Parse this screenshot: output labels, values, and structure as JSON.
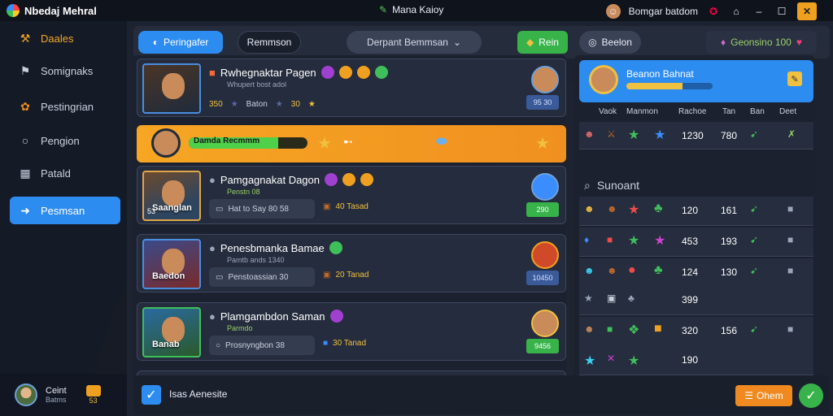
{
  "app": {
    "title": "Nbedaj Mehral",
    "center_title": "Mana Kaioy",
    "user": "Bomgar batdom"
  },
  "sidebar": {
    "items": [
      {
        "label": "Daales",
        "icon": "wrench-icon"
      },
      {
        "label": "Somignaks",
        "icon": "flag-icon"
      },
      {
        "label": "Pestingrian",
        "icon": "gear-icon"
      },
      {
        "label": "Pengion",
        "icon": "circle-icon"
      },
      {
        "label": "Patald",
        "icon": "grid-icon"
      },
      {
        "label": "Pesmsan",
        "icon": "arrow-icon"
      }
    ],
    "profile": {
      "name": "Ceint",
      "sub": "Batms",
      "level": "53"
    }
  },
  "header": {
    "tab_active": "Peringafer",
    "tab2": "Remmson",
    "dropdown": "Derpant Bemmsan",
    "btn_green": "Rein",
    "btn_grey": "Beelon",
    "btn_dark": "Geonsino 100"
  },
  "list": {
    "cards": [
      {
        "name": "Rwhegnaktar Pagen",
        "sub": "Whupert bost adol",
        "stat1": "350",
        "stat2": "Baton",
        "stat3": "30",
        "tag": "95 30"
      },
      {
        "name": "Pamgagnakat Dagon",
        "sub": "Penstn 08",
        "field": "Hat to Say 80 58",
        "coin": "40 Tasad",
        "tag": "290",
        "label": "Saanglan",
        "count": "53"
      },
      {
        "name": "Penesbmanka Bamae",
        "sub": "Pamtb ands 1340",
        "field": "Penstoassian 30",
        "coin": "20 Tanad",
        "tag": "10450",
        "label": "Baedon"
      },
      {
        "name": "Plamgambdon Saman",
        "sub": "Parmdo",
        "field": "Prosnyngbon 38",
        "coin": "30 Tanad",
        "tag": "9456",
        "label": "Banab"
      }
    ],
    "highlight": {
      "label": "Damda Recmmm",
      "progress": 0.75
    }
  },
  "right": {
    "header": {
      "title": "Beanon Bahnat",
      "progress": 0.65
    },
    "columns": [
      "Vaok",
      "Manmon",
      "Rachoe",
      "Tan",
      "Ban",
      "Deet"
    ],
    "section_title": "Sunoant",
    "rows": [
      {
        "a": "1230",
        "b": "780",
        "type": "top"
      },
      {
        "a": "120",
        "b": "161"
      },
      {
        "a": "453",
        "b": "193"
      },
      {
        "a": "124",
        "b": "130",
        "c": "399"
      },
      {
        "a": "320",
        "b": "156",
        "c": "190"
      },
      {
        "a": "320",
        "b": ""
      }
    ]
  },
  "bottom": {
    "checkbox_label": "Isas Aenesite",
    "ok_label": "Ohem"
  },
  "colors": {
    "accent": "#2d8cf0",
    "orange": "#f6a623",
    "green": "#37b34a"
  }
}
